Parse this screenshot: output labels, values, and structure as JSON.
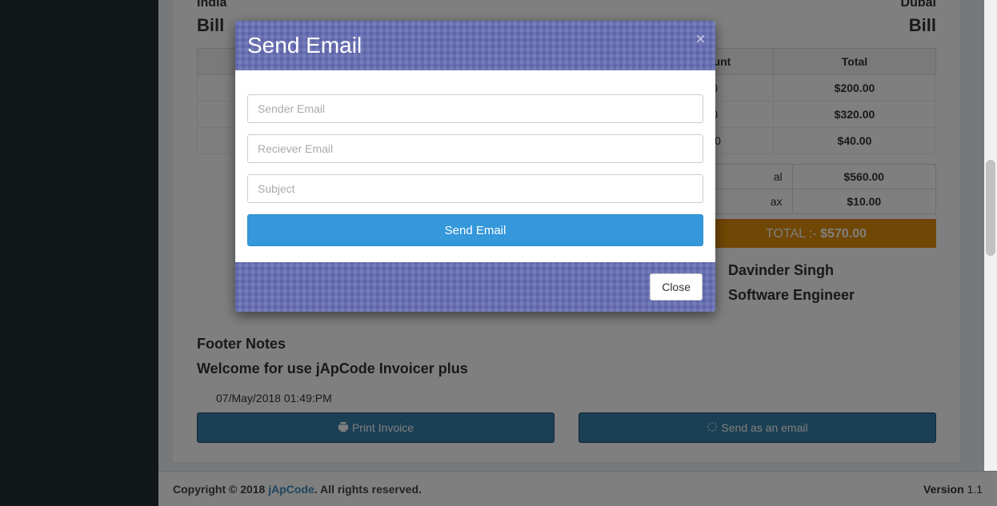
{
  "invoice": {
    "left_country": "India",
    "left_label": "Bill",
    "right_city": "Dubai",
    "right_label": "Bill",
    "headers": {
      "discount": "Discount",
      "total": "Total"
    },
    "rows": [
      {
        "discount": "0.00",
        "total": "$200.00"
      },
      {
        "discount": "0.00",
        "total": "$320.00"
      },
      {
        "discount": "10.00",
        "total": "$40.00"
      }
    ],
    "subtotals": {
      "subtotal_label_tail": "al",
      "subtotal_value": "$560.00",
      "tax_label_tail": "ax",
      "tax_value": "$10.00"
    },
    "grand_total": {
      "label": "TOTAL :-",
      "value": "$570.00"
    },
    "signature": {
      "name": "Davinder Singh",
      "title": "Software Engineer"
    },
    "footer_notes": {
      "heading": "Footer Notes",
      "text": "Welcome for use jApCode Invoicer plus"
    },
    "timestamp": "07/May/2018 01:49:PM",
    "actions": {
      "print": "Print Invoice",
      "send_email": "Send as an email"
    }
  },
  "modal": {
    "title": "Send Email",
    "sender_placeholder": "Sender Email",
    "receiver_placeholder": "Reciever Email",
    "subject_placeholder": "Subject",
    "submit_label": "Send Email",
    "close_label": "Close"
  },
  "footer": {
    "copyright_prefix": "Copyright © 2018 ",
    "brand": "jApCode",
    "copyright_suffix": ". All rights reserved.",
    "version_label": "Version",
    "version_value": "1.1"
  }
}
